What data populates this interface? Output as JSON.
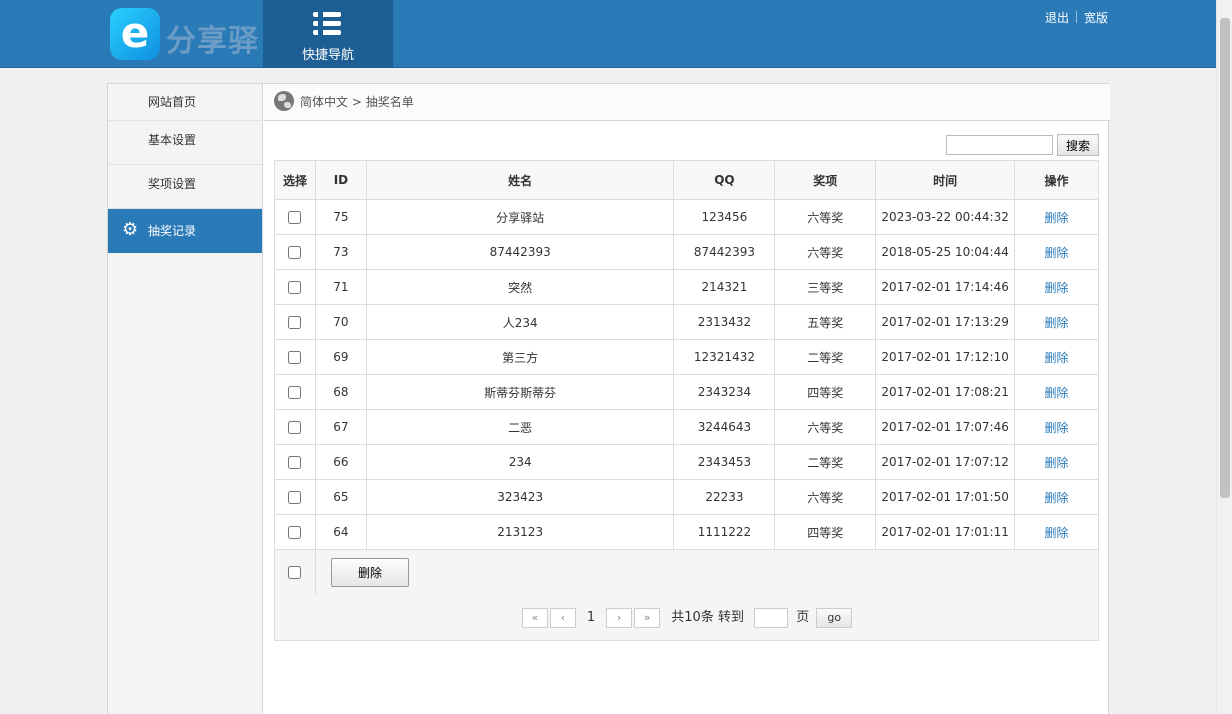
{
  "header": {
    "logo_letter": "e",
    "logo_text": "分享驿站",
    "quicknav_label": "快捷导航",
    "logout": "退出",
    "widescreen": "宽版"
  },
  "sidebar": {
    "items": [
      {
        "label": "网站首页"
      },
      {
        "label": "基本设置"
      },
      {
        "label": "奖项设置"
      },
      {
        "label": "抽奖记录"
      }
    ]
  },
  "breadcrumb": {
    "lang": "简体中文",
    "sep": ">",
    "page": "抽奖名单"
  },
  "search": {
    "value": "",
    "button": "搜索"
  },
  "table": {
    "headers": [
      "选择",
      "ID",
      "姓名",
      "QQ",
      "奖项",
      "时间",
      "操作"
    ],
    "rows": [
      {
        "id": "75",
        "name": "分享驿站",
        "qq": "123456",
        "prize": "六等奖",
        "time": "2023-03-22 00:44:32",
        "action": "删除"
      },
      {
        "id": "73",
        "name": "87442393",
        "qq": "87442393",
        "prize": "六等奖",
        "time": "2018-05-25 10:04:44",
        "action": "删除"
      },
      {
        "id": "71",
        "name": "突然",
        "qq": "214321",
        "prize": "三等奖",
        "time": "2017-02-01 17:14:46",
        "action": "删除"
      },
      {
        "id": "70",
        "name": "人234",
        "qq": "2313432",
        "prize": "五等奖",
        "time": "2017-02-01 17:13:29",
        "action": "删除"
      },
      {
        "id": "69",
        "name": "第三方",
        "qq": "12321432",
        "prize": "二等奖",
        "time": "2017-02-01 17:12:10",
        "action": "删除"
      },
      {
        "id": "68",
        "name": "斯蒂芬斯蒂芬",
        "qq": "2343234",
        "prize": "四等奖",
        "time": "2017-02-01 17:08:21",
        "action": "删除"
      },
      {
        "id": "67",
        "name": "二恶",
        "qq": "3244643",
        "prize": "六等奖",
        "time": "2017-02-01 17:07:46",
        "action": "删除"
      },
      {
        "id": "66",
        "name": "234",
        "qq": "2343453",
        "prize": "二等奖",
        "time": "2017-02-01 17:07:12",
        "action": "删除"
      },
      {
        "id": "65",
        "name": "323423",
        "qq": "22233",
        "prize": "六等奖",
        "time": "2017-02-01 17:01:50",
        "action": "删除"
      },
      {
        "id": "64",
        "name": "213123",
        "qq": "1111222",
        "prize": "四等奖",
        "time": "2017-02-01 17:01:11",
        "action": "删除"
      }
    ],
    "bulk_delete": "删除"
  },
  "pager": {
    "first": "«",
    "prev": "‹",
    "current": "1",
    "next": "›",
    "last": "»",
    "total": "共10条",
    "goto_label": "转到",
    "goto_value": "",
    "page_unit": "页",
    "go": "go"
  }
}
